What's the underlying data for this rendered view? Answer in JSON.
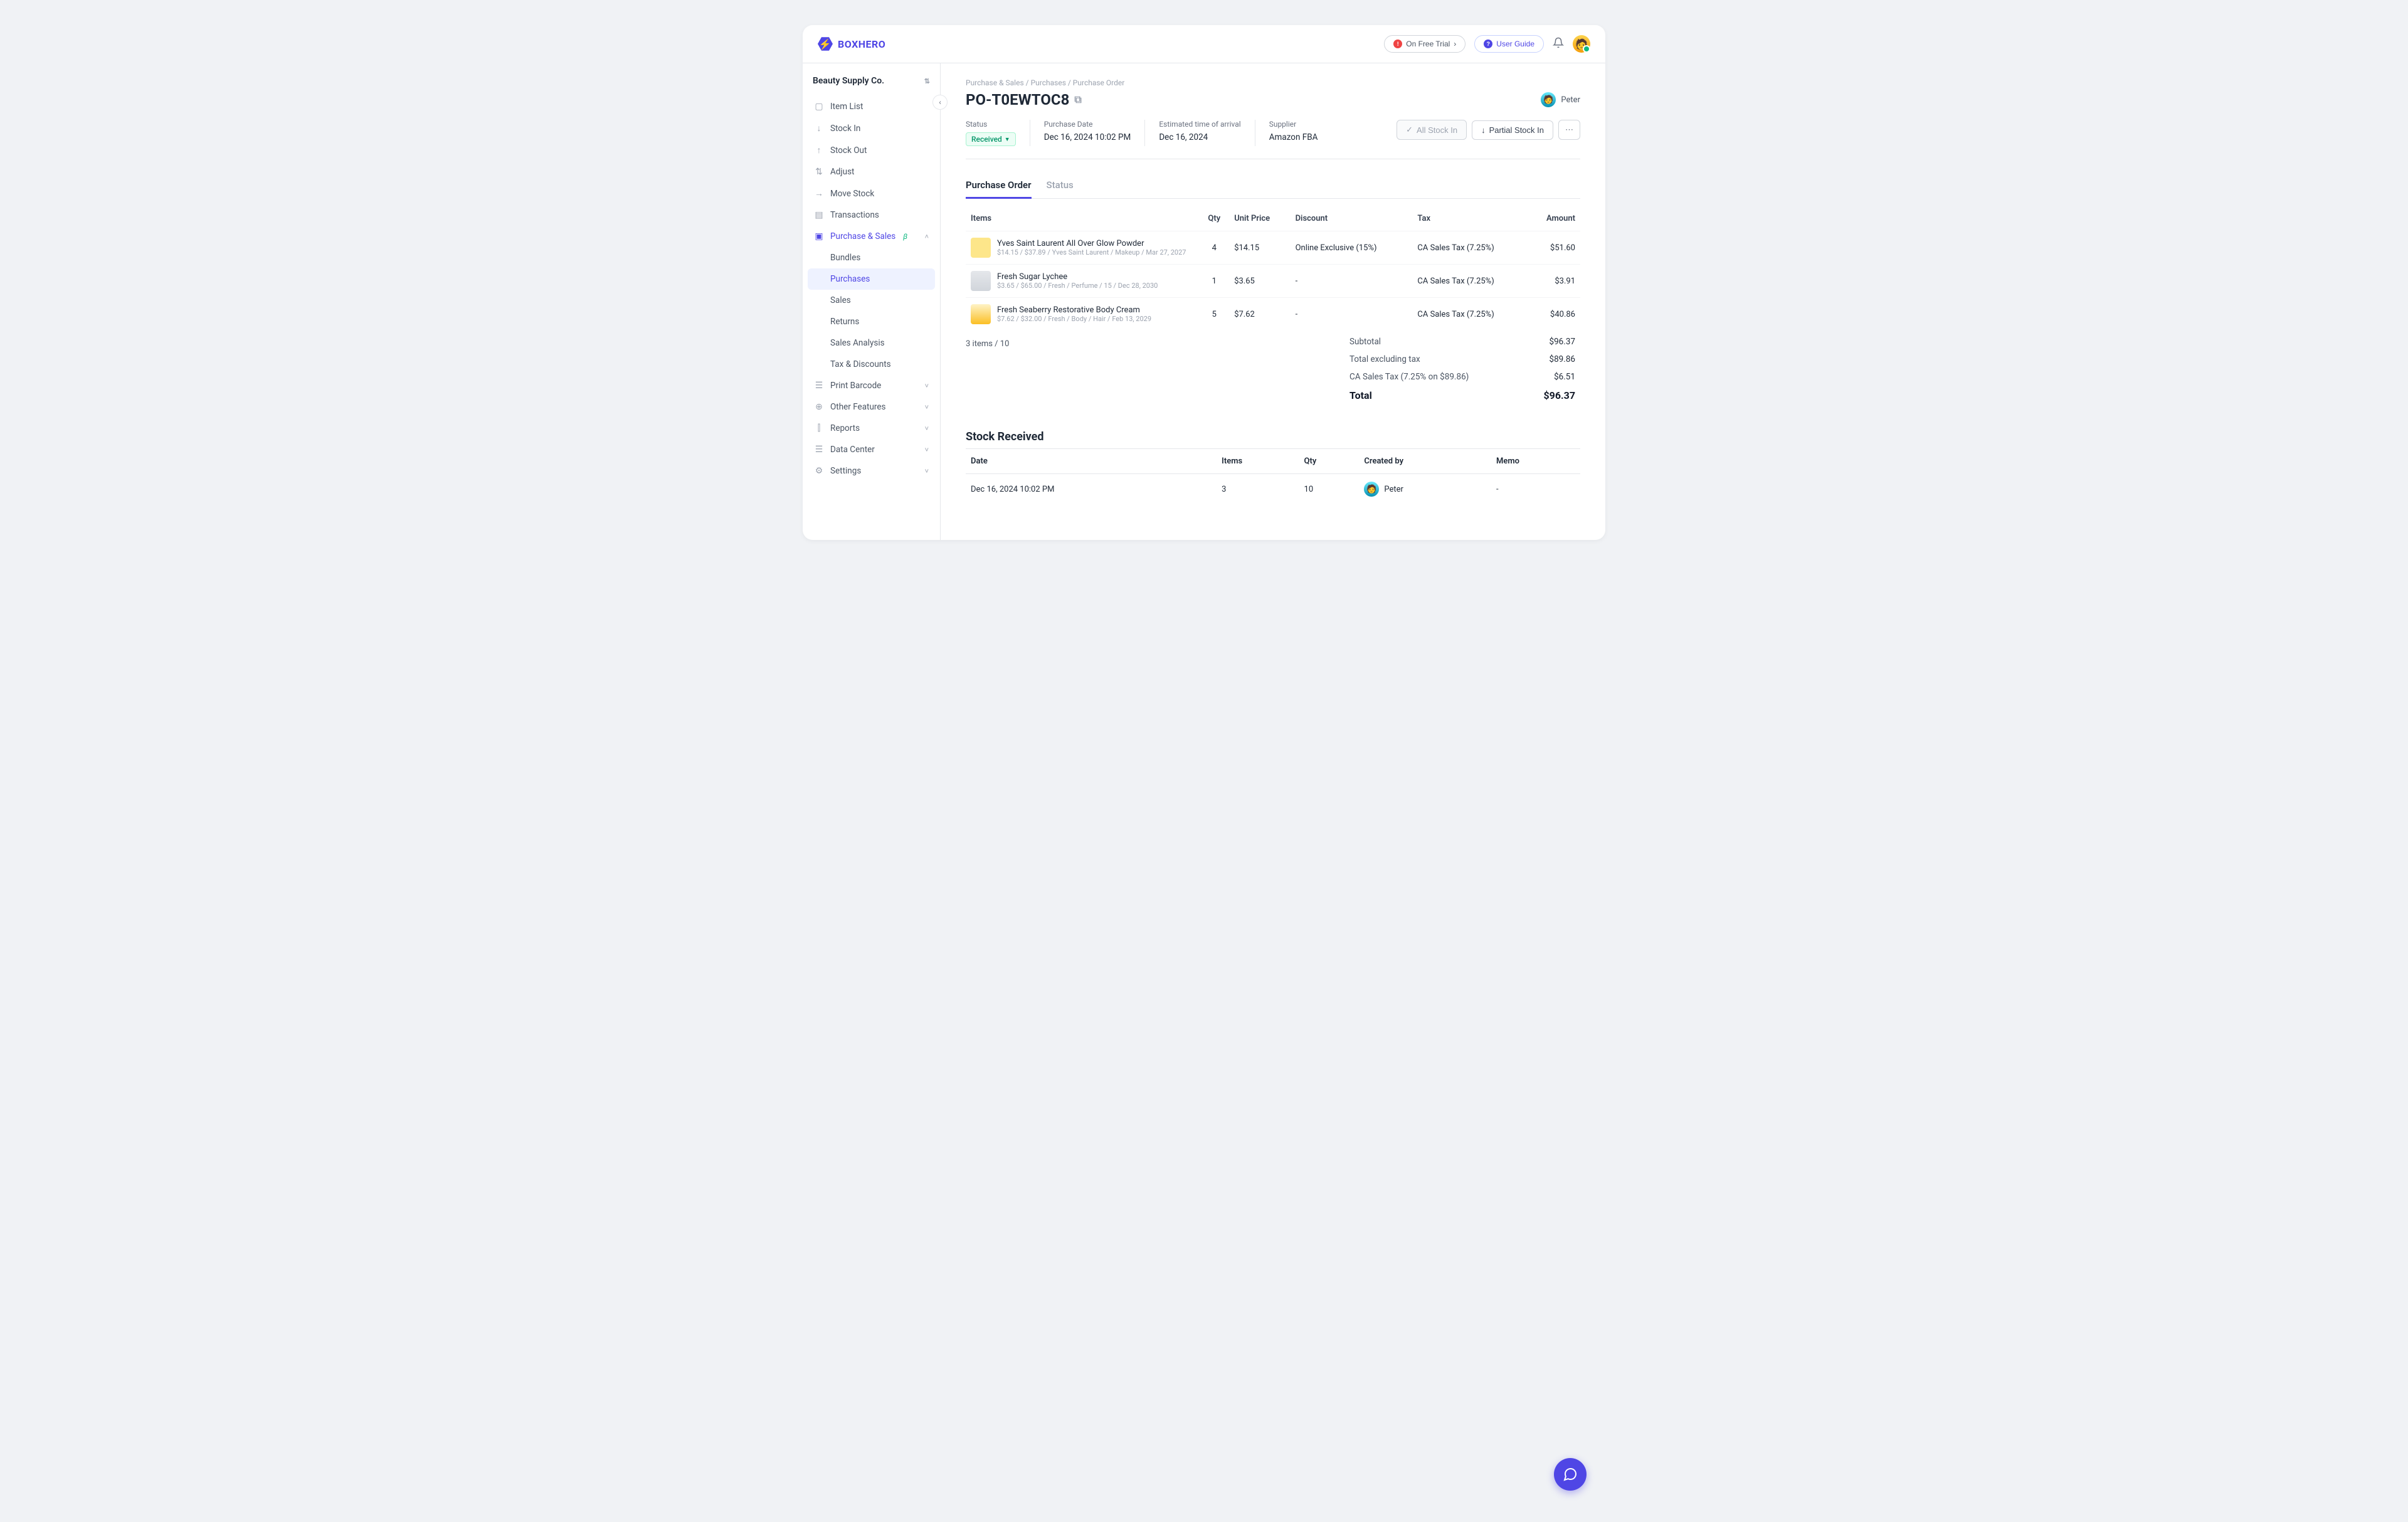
{
  "brand": {
    "name": "BOXHERO"
  },
  "header": {
    "trial": "On Free Trial",
    "guide": "User Guide"
  },
  "workspace": "Beauty Supply Co.",
  "sidebar": {
    "items": [
      "Item List",
      "Stock In",
      "Stock Out",
      "Adjust",
      "Move Stock",
      "Transactions"
    ],
    "purchase_section": "Purchase & Sales",
    "subitems": [
      "Bundles",
      "Purchases",
      "Sales",
      "Returns",
      "Sales Analysis",
      "Tax & Discounts"
    ],
    "lower": [
      "Print Barcode",
      "Other Features",
      "Reports",
      "Data Center",
      "Settings"
    ]
  },
  "breadcrumb": [
    "Purchase & Sales",
    "Purchases",
    "Purchase Order"
  ],
  "po": {
    "number": "PO-T0EWTOC8",
    "creator": "Peter",
    "status_label": "Status",
    "status": "Received",
    "purchase_date_label": "Purchase Date",
    "purchase_date": "Dec 16, 2024 10:02 PM",
    "eta_label": "Estimated time of arrival",
    "eta": "Dec 16, 2024",
    "supplier_label": "Supplier",
    "supplier": "Amazon FBA"
  },
  "actions": {
    "all_stock_in": "All Stock In",
    "partial_stock_in": "Partial Stock In"
  },
  "tabs": {
    "po": "Purchase Order",
    "status": "Status"
  },
  "table": {
    "headers": {
      "items": "Items",
      "qty": "Qty",
      "unit_price": "Unit Price",
      "discount": "Discount",
      "tax": "Tax",
      "amount": "Amount"
    },
    "rows": [
      {
        "name": "Yves Saint Laurent All Over Glow Powder",
        "meta": "$14.15 / $37.89 / Yves Saint Laurent / Makeup / Mar 27, 2027",
        "qty": "4",
        "unit_price": "$14.15",
        "discount": "Online Exclusive (15%)",
        "tax": "CA Sales Tax (7.25%)",
        "amount": "$51.60"
      },
      {
        "name": "Fresh Sugar Lychee",
        "meta": "$3.65 / $65.00 / Fresh / Perfume / 15 / Dec 28, 2030",
        "qty": "1",
        "unit_price": "$3.65",
        "discount": "-",
        "tax": "CA Sales Tax (7.25%)",
        "amount": "$3.91"
      },
      {
        "name": "Fresh Seaberry Restorative Body Cream",
        "meta": "$7.62 / $32.00 / Fresh / Body / Hair / Feb 13, 2029",
        "qty": "5",
        "unit_price": "$7.62",
        "discount": "-",
        "tax": "CA Sales Tax (7.25%)",
        "amount": "$40.86"
      }
    ],
    "counter": "3 items / 10"
  },
  "totals": {
    "subtotal_label": "Subtotal",
    "subtotal": "$96.37",
    "excl_tax_label": "Total excluding tax",
    "excl_tax": "$89.86",
    "tax_label": "CA Sales Tax (7.25% on $89.86)",
    "tax": "$6.51",
    "total_label": "Total",
    "total": "$96.37"
  },
  "received": {
    "title": "Stock Received",
    "headers": {
      "date": "Date",
      "items": "Items",
      "qty": "Qty",
      "by": "Created by",
      "memo": "Memo"
    },
    "row": {
      "date": "Dec 16, 2024 10:02 PM",
      "items": "3",
      "qty": "10",
      "by": "Peter",
      "memo": "-"
    }
  }
}
